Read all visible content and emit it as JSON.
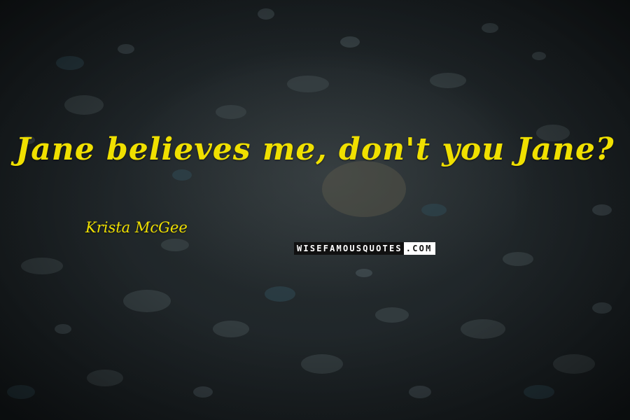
{
  "quote": {
    "text": "Jane believes me, don't you Jane?",
    "color": "#f0e000"
  },
  "author": {
    "name": "Krista McGee"
  },
  "watermark": {
    "text_dark": "WISEFAMOUSQUOTES",
    "text_light": ".COM"
  },
  "background": {
    "description_color": "#1f2527"
  }
}
